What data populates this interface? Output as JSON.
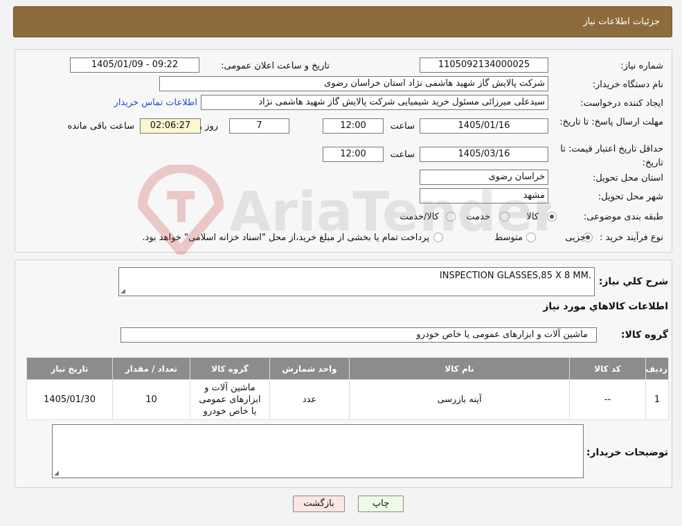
{
  "header": {
    "title": "جزئیات اطلاعات نیاز"
  },
  "form": {
    "need_number_label": "شماره نیاز:",
    "need_number": "1105092134000025",
    "announce_label": "تاریخ و ساعت اعلان عمومی:",
    "announce_value": "1405/01/09 - 09:22",
    "buyer_label": "نام دستگاه خریدار:",
    "buyer_value": "شرکت پالایش گاز شهید هاشمی نژاد   استان خراسان رضوی",
    "creator_label": "ایجاد کننده درخواست:",
    "creator_value": "سیدعلی میرزائی مسئول خرید شیمیایی شرکت پالایش گاز شهید هاشمی نژاد",
    "contact_link": "اطلاعات تماس خریدار",
    "deadline_label": "مهلت ارسال پاسخ: تا تاریخ:",
    "deadline_date": "1405/01/16",
    "time_label": "ساعت",
    "deadline_time": "12:00",
    "days_value": "7",
    "days_label": "روز و",
    "remaining_value": "02:06:27",
    "remaining_label": "ساعت باقی مانده",
    "validity_label": "حداقل تاریخ اعتبار قیمت: تا تاریخ:",
    "validity_date": "1405/03/16",
    "validity_time": "12:00",
    "province_label": "استان محل تحویل:",
    "province_value": "خراسان رضوی",
    "city_label": "شهر محل تحویل:",
    "city_value": "مشهد",
    "category_label": "طبقه بندی موضوعی:",
    "category_options": [
      "کالا",
      "خدمت",
      "کالا/خدمت"
    ],
    "process_label": "نوع فرآیند خرید :",
    "process_options": [
      "جزیی",
      "متوسط"
    ],
    "process_note": "پرداخت تمام یا بخشی از مبلغ خرید،از محل \"اسناد خزانه اسلامی\" خواهد بود."
  },
  "details": {
    "desc_label": "شرح کلي نیاز:",
    "desc_value": "INSPECTION GLASSES,85 X 8 MM.",
    "goods_title": "اطلاعات کالاهاي مورد نیاز",
    "group_label": "گروه کالا:",
    "group_value": "ماشین آلات و ابزارهای عمومی یا خاص خودرو",
    "table": {
      "headers": [
        "ردیف",
        "کد کالا",
        "نام کالا",
        "واحد شمارش",
        "گروه کالا",
        "تعداد / مقدار",
        "تاریخ نیاز"
      ],
      "rows": [
        [
          "1",
          "--",
          "آینه بازرسی",
          "عدد",
          "ماشین آلات و ابزارهای عمومی یا خاص خودرو",
          "10",
          "1405/01/30"
        ]
      ]
    },
    "buyer_notes_label": "توضیحات خریدار:",
    "buyer_notes_value": ""
  },
  "buttons": {
    "print": "چاپ",
    "back": "بازگشت"
  },
  "colors": {
    "header": "#8d6b3c",
    "table_header": "#8c8c8c",
    "link": "#1a4fd6",
    "print_btn": "#eefbe6",
    "back_btn": "#fde5e5"
  }
}
